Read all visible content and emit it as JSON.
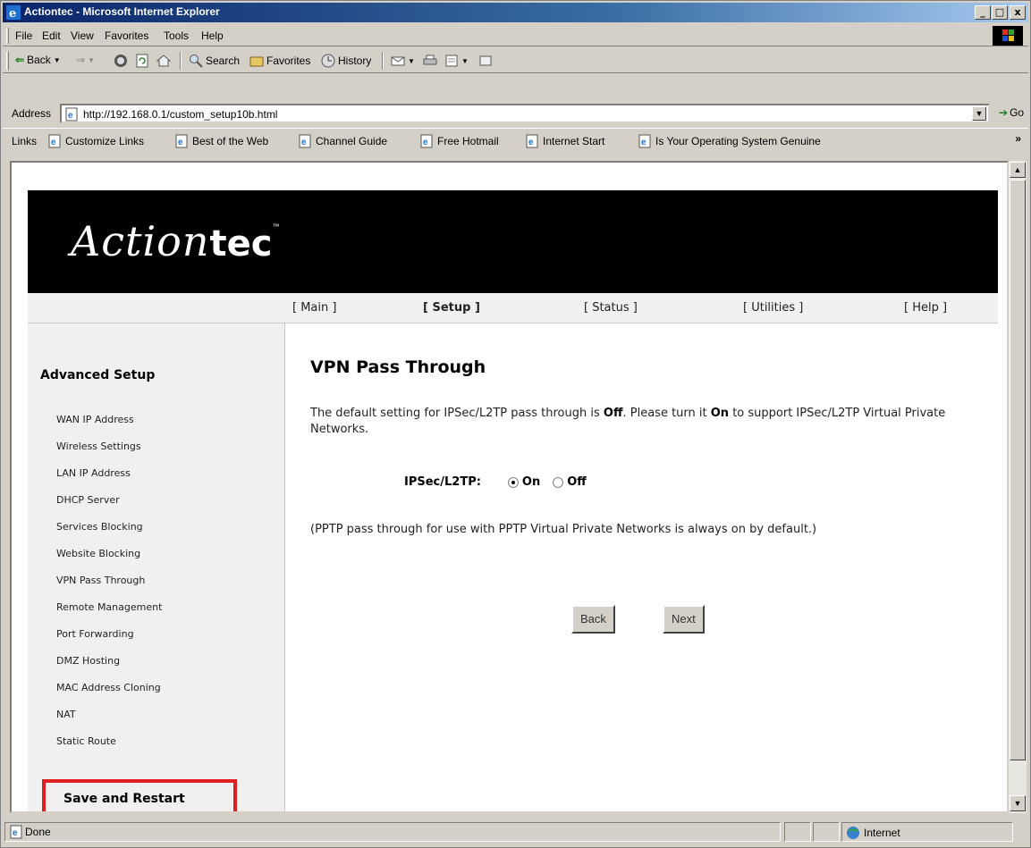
{
  "window": {
    "title": "Actiontec - Microsoft Internet Explorer",
    "controls": {
      "minimize": "_",
      "maximize": "□",
      "close": "x"
    }
  },
  "menu": [
    "File",
    "Edit",
    "View",
    "Favorites",
    "Tools",
    "Help"
  ],
  "toolbar": {
    "back": "Back",
    "search": "Search",
    "favorites": "Favorites",
    "history": "History"
  },
  "address": {
    "label": "Address",
    "url": "http://192.168.0.1/custom_setup10b.html",
    "go": "Go"
  },
  "links": {
    "label": "Links",
    "items": [
      "Customize Links",
      "Best of the Web",
      "Channel Guide",
      "Free Hotmail",
      "Internet Start",
      "Is Your Operating System Genuine"
    ],
    "more": "»"
  },
  "page": {
    "logo_script": "Action",
    "logo_bold": "tec",
    "logo_tm": "™",
    "nav": [
      "[ Main ]",
      "[ Setup ]",
      "[ Status ]",
      "[ Utilities ]",
      "[ Help ]"
    ],
    "nav_active_index": 1,
    "sidebar": {
      "heading": "Advanced Setup",
      "items": [
        "WAN IP Address",
        "Wireless Settings",
        "LAN IP Address",
        "DHCP Server",
        "Services Blocking",
        "Website Blocking",
        "VPN Pass Through",
        "Remote Management",
        "Port Forwarding",
        "DMZ Hosting",
        "MAC Address Cloning",
        "NAT",
        "Static Route"
      ],
      "save": "Save and Restart"
    },
    "main": {
      "title": "VPN Pass Through",
      "intro_1": "The default setting for IPSec/L2TP pass through is ",
      "intro_off": "Off",
      "intro_2": ". Please turn it ",
      "intro_on": "On",
      "intro_3": " to support IPSec/L2TP Virtual Private Networks.",
      "ipsec_label": "IPSec/L2TP:",
      "option_on": "On",
      "option_off": "Off",
      "selected": "On",
      "note": "(PPTP pass through for use with PPTP Virtual Private Networks is always on by default.)",
      "back_button": "Back",
      "next_button": "Next"
    }
  },
  "status": {
    "text": "Done",
    "zone": "Internet"
  },
  "colors": {
    "titlebar": "#0a246a",
    "banner": "#000000",
    "highlight_box": "#e02020",
    "chrome": "#d4d0c8"
  }
}
